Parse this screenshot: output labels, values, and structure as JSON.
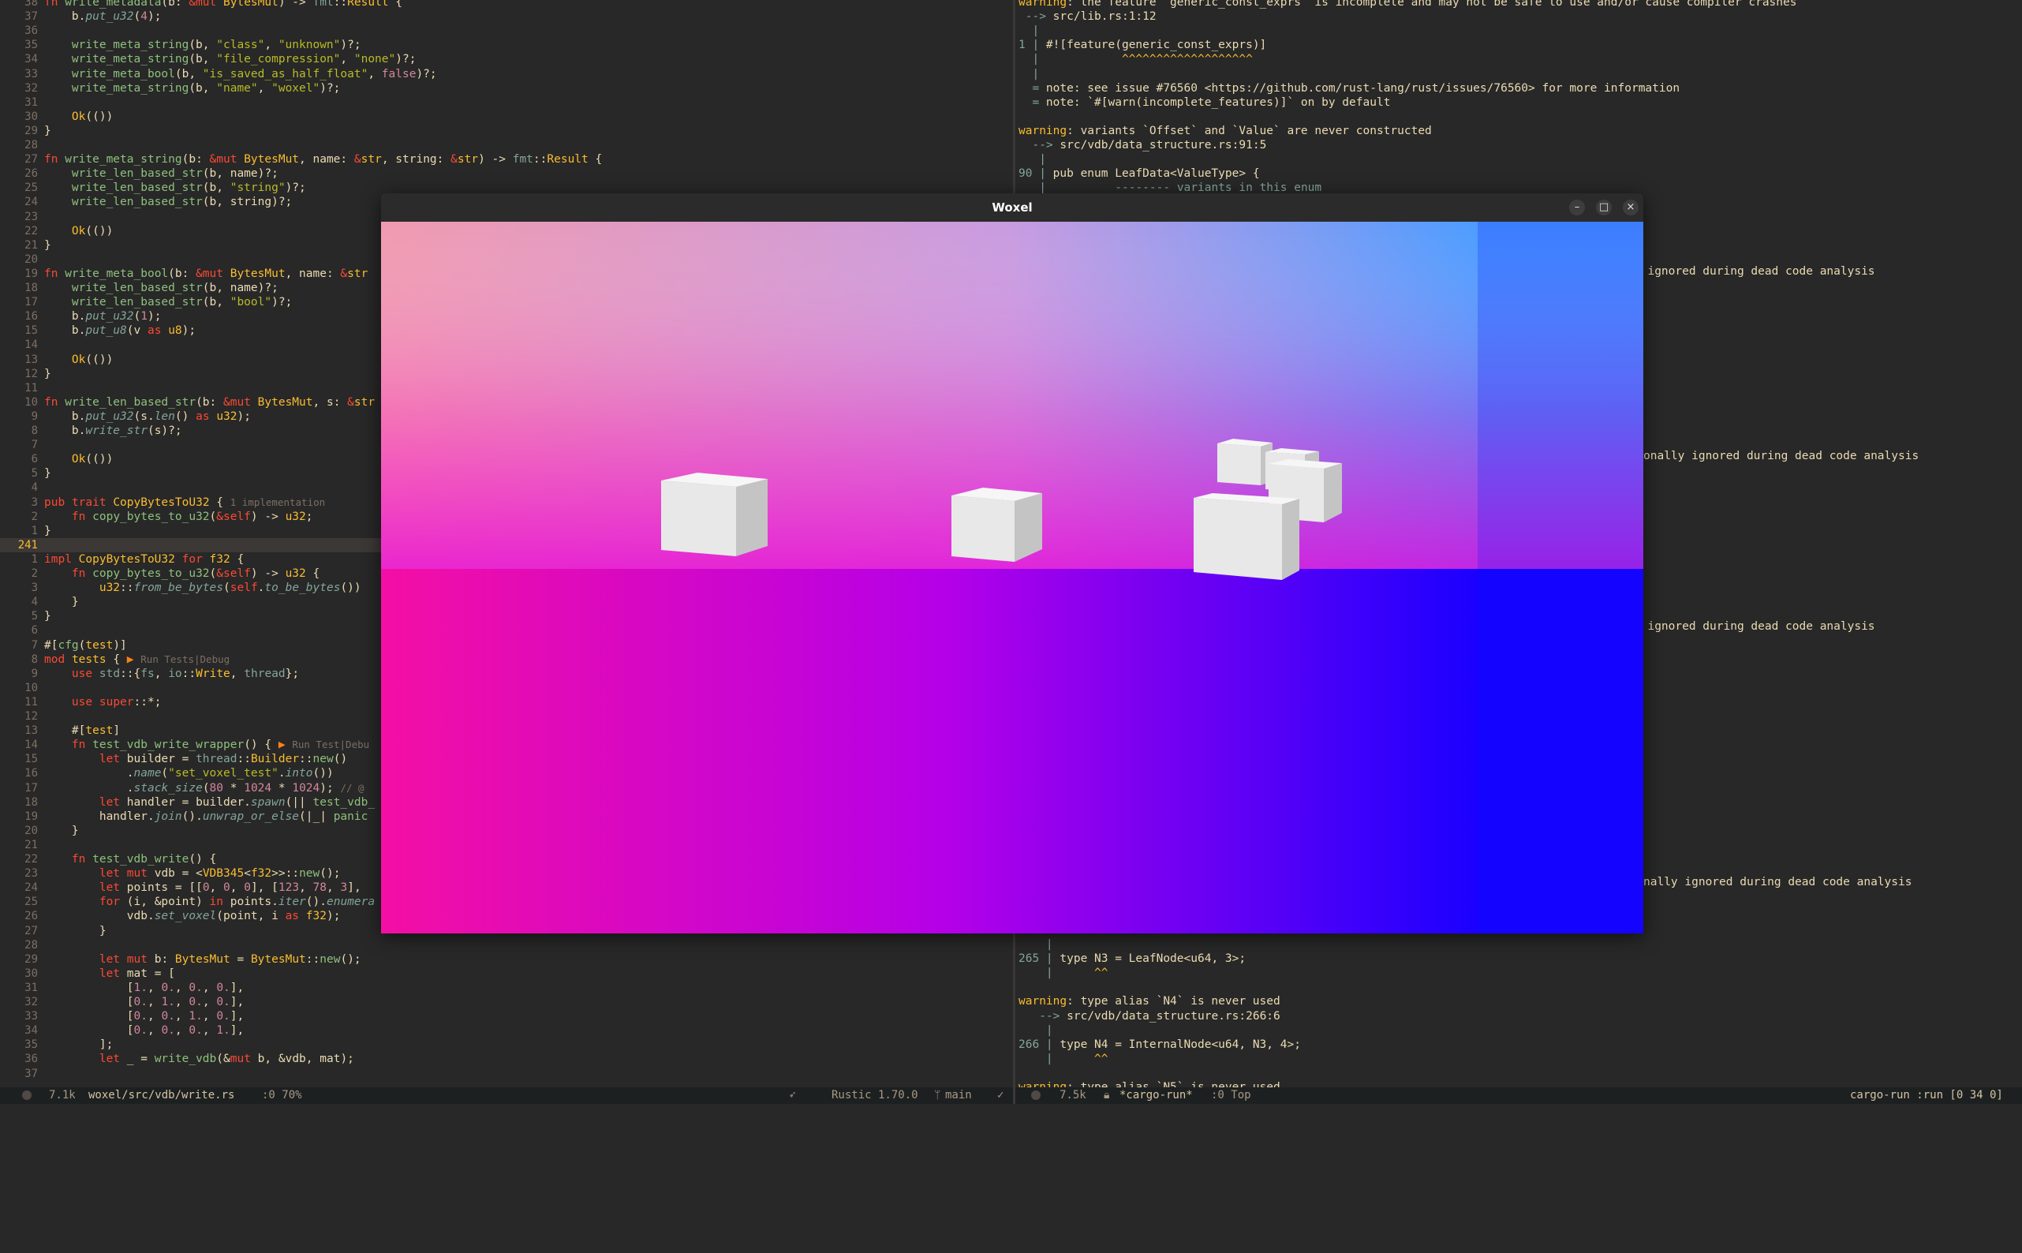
{
  "editor": {
    "lines": [
      {
        "n": "38",
        "h": "<span class=\"k\">fn</span> <span class=\"f\">write_metadata</span>(b: <span class=\"k\">&amp;mut</span> <span class=\"t\">BytesMut</span>) -&gt; <span class=\"p\">fmt</span>::<span class=\"t\">Result</span> {"
      },
      {
        "n": "37",
        "h": "    b.<span class=\"m\">put_u32</span>(<span class=\"n\">4</span>);"
      },
      {
        "n": "36",
        "h": ""
      },
      {
        "n": "35",
        "h": "    <span class=\"f\">write_meta_string</span>(b, <span class=\"s\">\"class\"</span>, <span class=\"s\">\"unknown\"</span>)?;"
      },
      {
        "n": "34",
        "h": "    <span class=\"f\">write_meta_string</span>(b, <span class=\"s\">\"file_compression\"</span>, <span class=\"s\">\"none\"</span>)?;"
      },
      {
        "n": "33",
        "h": "    <span class=\"f\">write_meta_bool</span>(b, <span class=\"s\">\"is_saved_as_half_float\"</span>, <span class=\"n\">false</span>)?;"
      },
      {
        "n": "32",
        "h": "    <span class=\"f\">write_meta_string</span>(b, <span class=\"s\">\"name\"</span>, <span class=\"s\">\"woxel\"</span>)?;"
      },
      {
        "n": "31",
        "h": ""
      },
      {
        "n": "30",
        "h": "    <span class=\"t\">Ok</span>(())"
      },
      {
        "n": "29",
        "h": "}"
      },
      {
        "n": "28",
        "h": ""
      },
      {
        "n": "27",
        "h": "<span class=\"k\">fn</span> <span class=\"f\">write_meta_string</span>(b: <span class=\"k\">&amp;mut</span> <span class=\"t\">BytesMut</span>, name: <span class=\"k\">&amp;</span><span class=\"t\">str</span>, string: <span class=\"k\">&amp;</span><span class=\"t\">str</span>) -&gt; <span class=\"p\">fmt</span>::<span class=\"t\">Result</span> {"
      },
      {
        "n": "26",
        "h": "    <span class=\"f\">write_len_based_str</span>(b, name)?;"
      },
      {
        "n": "25",
        "h": "    <span class=\"f\">write_len_based_str</span>(b, <span class=\"s\">\"string\"</span>)?;"
      },
      {
        "n": "24",
        "h": "    <span class=\"f\">write_len_based_str</span>(b, string)?;"
      },
      {
        "n": "23",
        "h": ""
      },
      {
        "n": "22",
        "h": "    <span class=\"t\">Ok</span>(())"
      },
      {
        "n": "21",
        "h": "}"
      },
      {
        "n": "20",
        "h": ""
      },
      {
        "n": "19",
        "h": "<span class=\"k\">fn</span> <span class=\"f\">write_meta_bool</span>(b: <span class=\"k\">&amp;mut</span> <span class=\"t\">BytesMut</span>, name: <span class=\"k\">&amp;</span><span class=\"t\">str</span>"
      },
      {
        "n": "18",
        "h": "    <span class=\"f\">write_len_based_str</span>(b, name)?;"
      },
      {
        "n": "17",
        "h": "    <span class=\"f\">write_len_based_str</span>(b, <span class=\"s\">\"bool\"</span>)?;"
      },
      {
        "n": "16",
        "h": "    b.<span class=\"m\">put_u32</span>(<span class=\"n\">1</span>);"
      },
      {
        "n": "15",
        "h": "    b.<span class=\"m\">put_u8</span>(v <span class=\"k\">as</span> <span class=\"t\">u8</span>);"
      },
      {
        "n": "14",
        "h": ""
      },
      {
        "n": "13",
        "h": "    <span class=\"t\">Ok</span>(())"
      },
      {
        "n": "12",
        "h": "}"
      },
      {
        "n": "11",
        "h": ""
      },
      {
        "n": "10",
        "h": "<span class=\"k\">fn</span> <span class=\"f\">write_len_based_str</span>(b: <span class=\"k\">&amp;mut</span> <span class=\"t\">BytesMut</span>, s: <span class=\"k\">&amp;</span><span class=\"t\">str</span>"
      },
      {
        "n": "9",
        "h": "    b.<span class=\"m\">put_u32</span>(s.<span class=\"m\">len</span>() <span class=\"k\">as</span> <span class=\"t\">u32</span>);"
      },
      {
        "n": "8",
        "h": "    b.<span class=\"m\">write_str</span>(s)?;"
      },
      {
        "n": "7",
        "h": ""
      },
      {
        "n": "6",
        "h": "    <span class=\"t\">Ok</span>(())"
      },
      {
        "n": "5",
        "h": "}"
      },
      {
        "n": "4",
        "h": ""
      },
      {
        "n": "3",
        "h": "<span class=\"k\">pub</span> <span class=\"k\">trait</span> <span class=\"t\">CopyBytesToU32</span> { <span class=\"hint\">1 implementation</span>"
      },
      {
        "n": "2",
        "h": "    <span class=\"k\">fn</span> <span class=\"f\">copy_bytes_to_u32</span>(<span class=\"k\">&amp;self</span>) -&gt; <span class=\"t\">u32</span>;"
      },
      {
        "n": "1",
        "h": "}"
      },
      {
        "n": "241",
        "h": "",
        "current": true
      },
      {
        "n": "1",
        "h": "<span class=\"k\">impl</span> <span class=\"t\">CopyBytesToU32</span> <span class=\"k\">for</span> <span class=\"t\">f32</span> {"
      },
      {
        "n": "2",
        "h": "    <span class=\"k\">fn</span> <span class=\"f\">copy_bytes_to_u32</span>(<span class=\"k\">&amp;self</span>) -&gt; <span class=\"t\">u32</span> {"
      },
      {
        "n": "3",
        "h": "        <span class=\"t\">u32</span>::<span class=\"m\">from_be_bytes</span>(<span class=\"k\">self</span>.<span class=\"m\">to_be_bytes</span>())"
      },
      {
        "n": "4",
        "h": "    }"
      },
      {
        "n": "5",
        "h": "}"
      },
      {
        "n": "6",
        "h": ""
      },
      {
        "n": "7",
        "h": "#[<span class=\"f\">cfg</span>(<span class=\"t\">test</span>)]"
      },
      {
        "n": "8",
        "h": "<span class=\"k\">mod</span> <span class=\"t\">tests</span> { <span class=\"run\">▶</span> <span class=\"hint\">Run Tests|Debug</span>"
      },
      {
        "n": "9",
        "h": "    <span class=\"k\">use</span> <span class=\"p\">std</span>::{<span class=\"p\">fs</span>, <span class=\"p\">io</span>::<span class=\"t\">Write</span>, <span class=\"p\">thread</span>};"
      },
      {
        "n": "10",
        "h": ""
      },
      {
        "n": "11",
        "h": "    <span class=\"k\">use</span> <span class=\"k\">super</span>::*;"
      },
      {
        "n": "12",
        "h": ""
      },
      {
        "n": "13",
        "h": "    #[<span class=\"t\">test</span>]"
      },
      {
        "n": "14",
        "h": "    <span class=\"k\">fn</span> <span class=\"f\">test_vdb_write_wrapper</span>() { <span class=\"run\">▶</span> <span class=\"hint\">Run Test|Debu</span>"
      },
      {
        "n": "15",
        "h": "        <span class=\"k\">let</span> builder = <span class=\"p\">thread</span>::<span class=\"t\">Builder</span>::<span class=\"f\">new</span>()"
      },
      {
        "n": "16",
        "h": "            .<span class=\"m\">name</span>(<span class=\"s\">\"set_voxel_test\"</span>.<span class=\"m\">into</span>())"
      },
      {
        "n": "17",
        "h": "            .<span class=\"m\">stack_size</span>(<span class=\"n\">80</span> * <span class=\"n\">1024</span> * <span class=\"n\">1024</span>); <span class=\"hint\">// @</span>"
      },
      {
        "n": "18",
        "h": "        <span class=\"k\">let</span> handler = builder.<span class=\"m\">spawn</span>(|| <span class=\"f\">test_vdb_</span>"
      },
      {
        "n": "19",
        "h": "        handler.<span class=\"m\">join</span>().<span class=\"m\">unwrap_or_else</span>(|_| <span class=\"f\">panic</span>"
      },
      {
        "n": "20",
        "h": "    }"
      },
      {
        "n": "21",
        "h": ""
      },
      {
        "n": "22",
        "h": "    <span class=\"k\">fn</span> <span class=\"f\">test_vdb_write</span>() {"
      },
      {
        "n": "23",
        "h": "        <span class=\"k\">let</span> <span class=\"k\">mut</span> vdb = &lt;<span class=\"t\">VDB345</span>&lt;<span class=\"t\">f32</span>&gt;&gt;::<span class=\"f\">new</span>();"
      },
      {
        "n": "24",
        "h": "        <span class=\"k\">let</span> points = [[<span class=\"n\">0</span>, <span class=\"n\">0</span>, <span class=\"n\">0</span>], [<span class=\"n\">123</span>, <span class=\"n\">78</span>, <span class=\"n\">3</span>],"
      },
      {
        "n": "25",
        "h": "        <span class=\"k\">for</span> (i, &amp;point) <span class=\"k\">in</span> points.<span class=\"m\">iter</span>().<span class=\"m\">enumera</span>"
      },
      {
        "n": "26",
        "h": "            vdb.<span class=\"m\">set_voxel</span>(point, i <span class=\"k\">as</span> <span class=\"t\">f32</span>);"
      },
      {
        "n": "27",
        "h": "        }"
      },
      {
        "n": "28",
        "h": ""
      },
      {
        "n": "29",
        "h": "        <span class=\"k\">let</span> <span class=\"k\">mut</span> b: <span class=\"t\">BytesMut</span> = <span class=\"t\">BytesMut</span>::<span class=\"f\">new</span>();"
      },
      {
        "n": "30",
        "h": "        <span class=\"k\">let</span> mat = ["
      },
      {
        "n": "31",
        "h": "            [<span class=\"n\">1.</span>, <span class=\"n\">0.</span>, <span class=\"n\">0.</span>, <span class=\"n\">0.</span>],"
      },
      {
        "n": "32",
        "h": "            [<span class=\"n\">0.</span>, <span class=\"n\">1.</span>, <span class=\"n\">0.</span>, <span class=\"n\">0.</span>],"
      },
      {
        "n": "33",
        "h": "            [<span class=\"n\">0.</span>, <span class=\"n\">0.</span>, <span class=\"n\">1.</span>, <span class=\"n\">0.</span>],"
      },
      {
        "n": "34",
        "h": "            [<span class=\"n\">0.</span>, <span class=\"n\">0.</span>, <span class=\"n\">0.</span>, <span class=\"n\">1.</span>],"
      },
      {
        "n": "35",
        "h": "        ];"
      },
      {
        "n": "36",
        "h": "        <span class=\"k\">let</span> _ = <span class=\"f\">write_vdb</span>(&amp;<span class=\"k\">mut</span> b, &amp;vdb, mat);"
      },
      {
        "n": "37",
        "h": ""
      }
    ],
    "status": {
      "size": "7.1k",
      "path": "woxel/src/vdb/write.rs",
      "pos": ":0 70%",
      "lsp": "Rustic 1.70.0",
      "branch": "main",
      "check": "✓"
    }
  },
  "output": {
    "lines": [
      {
        "h": "<span class=\"warn\">warning</span>: the feature `generic_const_exprs` is incomplete and may not be safe to use and/or cause compiler crashes"
      },
      {
        "h": " <span class=\"arrow\">--&gt;</span> src/lib.rs:1:12"
      },
      {
        "h": "  <span class=\"gut\">|</span>"
      },
      {
        "h": "<span class=\"gut\">1 |</span> #![feature(generic_const_exprs)]"
      },
      {
        "h": "  <span class=\"gut\">|</span>            <span class=\"caret\">^^^^^^^^^^^^^^^^^^^</span>"
      },
      {
        "h": "  <span class=\"gut\">|</span>"
      },
      {
        "h": "  <span class=\"gut\">=</span> note: see issue #76560 &lt;https://github.com/rust-lang/rust/issues/76560&gt; for more information"
      },
      {
        "h": "  <span class=\"gut\">=</span> note: `#[warn(incomplete_features)]` on by default"
      },
      {
        "h": ""
      },
      {
        "h": "<span class=\"warn\">warning</span>: variants `Offset` and `Value` are never constructed"
      },
      {
        "h": "  <span class=\"arrow\">--&gt;</span> src/vdb/data_structure.rs:91:5"
      },
      {
        "h": "   <span class=\"gut\">|</span>"
      },
      {
        "h": "<span class=\"gut\">90 |</span> pub enum LeafData&lt;ValueType&gt; {"
      },
      {
        "h": "   <span class=\"gut\">|</span>          <span class=\"gut\">-------- variants in this enum</span>"
      }
    ],
    "tail_lines": [
      {
        "h": "    <span class=\"gut\">|</span>"
      },
      {
        "h": "<span class=\"gut\">265 |</span> type N3 = LeafNode&lt;u64, 3&gt;;"
      },
      {
        "h": "    <span class=\"gut\">|</span>      <span class=\"caret\">^^</span>"
      },
      {
        "h": ""
      },
      {
        "h": "<span class=\"warn\">warning</span>: type alias `N4` is never used"
      },
      {
        "h": "   <span class=\"arrow\">--&gt;</span> src/vdb/data_structure.rs:266:6"
      },
      {
        "h": "    <span class=\"gut\">|</span>"
      },
      {
        "h": "<span class=\"gut\">266 |</span> type N4 = InternalNode&lt;u64, N3, 4&gt;;"
      },
      {
        "h": "    <span class=\"gut\">|</span>      <span class=\"caret\">^^</span>"
      },
      {
        "h": ""
      },
      {
        "h": "<span class=\"warn\">warning</span>: type alias `N5` is never used"
      }
    ],
    "peek_text": {
      "a": "y ignored during dead code analysis",
      "b": "onally ignored during dead code analysis",
      "c": "y ignored during dead code analysis",
      "d": "nally ignored during dead code analysis"
    },
    "status": {
      "size": "7.5k",
      "buffer": "*cargo-run*",
      "pos": ":0 Top",
      "mode": "cargo-run :run [0 34 0]"
    }
  },
  "woxel": {
    "title": "Woxel",
    "minimize": "–",
    "maximize": "□",
    "close": "×",
    "colors": {
      "sky_top_left": "#f09ab0",
      "sky_top_mid": "#c89be0",
      "sky_top_right": "#4d9cff",
      "ground_left": "#f40fa4",
      "ground_mid": "#b400e8",
      "ground_right": "#1a00ff",
      "cube_front": "#e8e8e8",
      "cube_top": "#f6f6f6",
      "cube_side": "#c4c4c4"
    }
  }
}
